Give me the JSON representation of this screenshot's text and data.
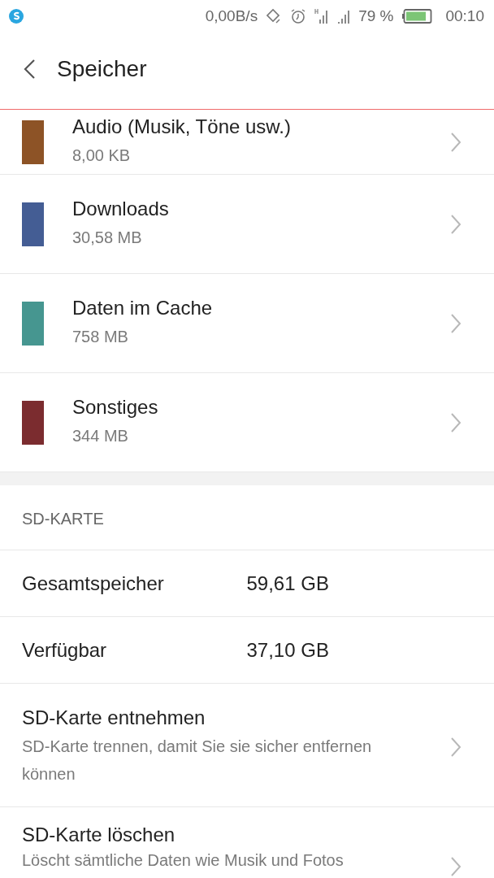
{
  "status_bar": {
    "speed": "0,00B/s",
    "battery_percent": "79 %",
    "time": "00:10"
  },
  "header": {
    "title": "Speicher"
  },
  "categories": [
    {
      "name": "Audio (Musik, Töne usw.)",
      "size": "8,00 KB",
      "color": "#8d5326"
    },
    {
      "name": "Downloads",
      "size": "30,58 MB",
      "color": "#445d94"
    },
    {
      "name": "Daten im Cache",
      "size": "758 MB",
      "color": "#469690"
    },
    {
      "name": "Sonstiges",
      "size": "344 MB",
      "color": "#7b2c2f"
    }
  ],
  "sd_card": {
    "heading": "SD-KARTE",
    "stats": [
      {
        "label": "Gesamtspeicher",
        "value": "59,61 GB"
      },
      {
        "label": "Verfügbar",
        "value": "37,10 GB"
      }
    ],
    "actions": [
      {
        "title": "SD-Karte entnehmen",
        "description": "SD-Karte trennen, damit Sie sie sicher entfernen können"
      },
      {
        "title": "SD-Karte löschen",
        "description": "Löscht sämtliche Daten wie Musik und Fotos"
      }
    ]
  }
}
